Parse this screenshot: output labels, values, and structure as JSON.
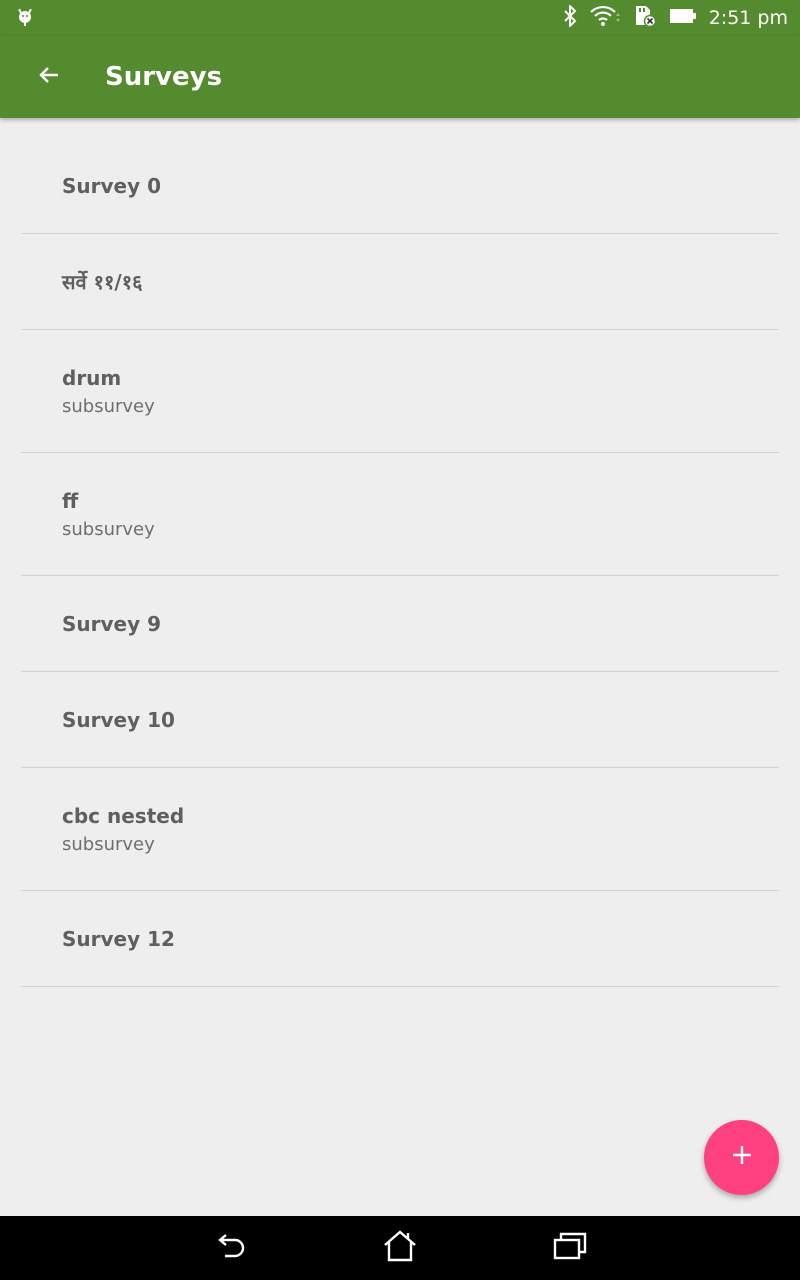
{
  "status_bar": {
    "time": "2:51 pm",
    "icons": [
      "android-debug-icon",
      "bluetooth-icon",
      "wifi-icon",
      "sd-card-icon",
      "battery-icon"
    ]
  },
  "app_bar": {
    "title": "Surveys",
    "back_icon": "arrow-back-icon"
  },
  "surveys": [
    {
      "title": "Survey 0",
      "subtitle": ""
    },
    {
      "title": "सर्वे ११/१६",
      "subtitle": ""
    },
    {
      "title": "drum",
      "subtitle": "subsurvey"
    },
    {
      "title": "ff",
      "subtitle": "subsurvey"
    },
    {
      "title": "Survey 9",
      "subtitle": ""
    },
    {
      "title": "Survey 10",
      "subtitle": ""
    },
    {
      "title": "cbc nested",
      "subtitle": "subsurvey"
    },
    {
      "title": "Survey 12",
      "subtitle": ""
    }
  ],
  "fab": {
    "icon": "plus-icon"
  },
  "nav_bar": {
    "icons": [
      "back-icon",
      "home-icon",
      "recents-icon"
    ]
  },
  "colors": {
    "primary": "#558b2f",
    "accent": "#ff4081",
    "background": "#eeeeee"
  }
}
